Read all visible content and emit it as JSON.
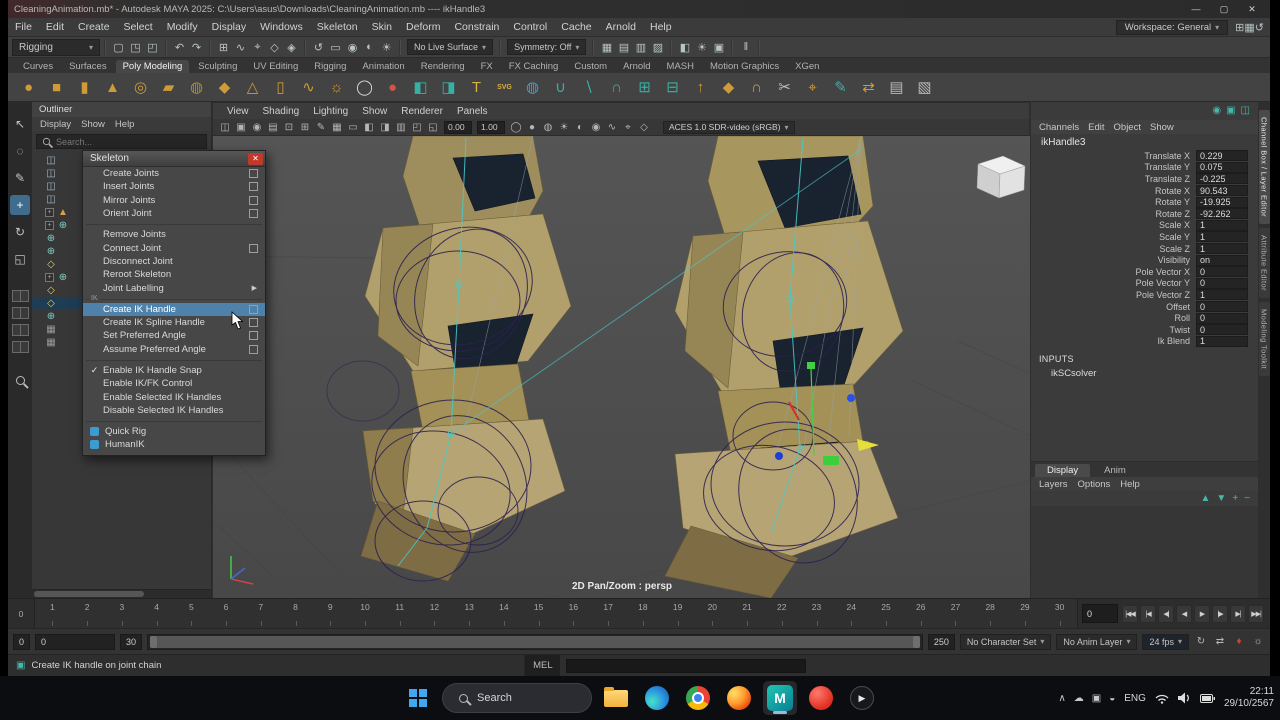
{
  "window": {
    "title": "CleaningAnimation.mb* - Autodesk MAYA 2025: C:\\Users\\asus\\Downloads\\CleaningAnimation.mb  ----  ikHandle3",
    "minimize": "—",
    "maximize": "▢",
    "close": "✕"
  },
  "menubar": {
    "items": [
      "File",
      "Edit",
      "Create",
      "Select",
      "Modify",
      "Display",
      "Windows",
      "Skeleton",
      "Skin",
      "Deform",
      "Constrain",
      "Control",
      "Cache",
      "Arnold",
      "Help"
    ],
    "workspace": "Workspace: General",
    "right_icons": [
      {
        "name": "workspace-layout-icon",
        "glyph": "⊞"
      },
      {
        "name": "panel-grid-icon",
        "glyph": "▦"
      },
      {
        "name": "reset-workspace-icon",
        "glyph": "↺"
      }
    ]
  },
  "statusline": {
    "mode": "Rigging",
    "no_live_surface": "No Live Surface",
    "symmetry": "Symmetry: Off",
    "groups_left": [
      [
        {
          "name": "new-scene-icon",
          "glyph": "▢"
        },
        {
          "name": "open-scene-icon",
          "glyph": "◳"
        },
        {
          "name": "save-scene-icon",
          "glyph": "◰"
        }
      ],
      [
        {
          "name": "undo-icon",
          "glyph": "↶"
        },
        {
          "name": "redo-icon",
          "glyph": "↷"
        }
      ],
      [
        {
          "name": "snap-grid-icon",
          "glyph": "⊞"
        },
        {
          "name": "snap-curve-icon",
          "glyph": "∿"
        },
        {
          "name": "snap-point-icon",
          "glyph": "⌖"
        },
        {
          "name": "snap-plane-icon",
          "glyph": "◇"
        },
        {
          "name": "make-live-icon",
          "glyph": "◈"
        }
      ],
      [
        {
          "name": "construction-history-icon",
          "glyph": "↺"
        },
        {
          "name": "open-render-view-icon",
          "glyph": "▭"
        },
        {
          "name": "render-frame-icon",
          "glyph": "◉"
        },
        {
          "name": "ipr-render-icon",
          "glyph": "◐"
        },
        {
          "name": "render-settings-icon",
          "glyph": "☀"
        }
      ]
    ],
    "groups_right": [
      [
        {
          "name": "grid-display-icon",
          "glyph": "▦"
        },
        {
          "name": "isolate-select-icon",
          "glyph": "▤"
        },
        {
          "name": "wireframe-icon",
          "glyph": "▥"
        },
        {
          "name": "shaded-display-icon",
          "glyph": "▨"
        }
      ],
      [
        {
          "name": "xray-icon",
          "glyph": "◧"
        },
        {
          "name": "lighting-icon",
          "glyph": "☀"
        },
        {
          "name": "textured-icon",
          "glyph": "▣"
        }
      ],
      [
        {
          "name": "pause-viewport-icon",
          "glyph": "‖"
        }
      ]
    ]
  },
  "shelf": {
    "tabs": [
      "Curves",
      "Surfaces",
      "Poly Modeling",
      "Sculpting",
      "UV Editing",
      "Rigging",
      "Animation",
      "Rendering",
      "FX",
      "FX Caching",
      "Custom",
      "Arnold",
      "MASH",
      "Motion Graphics",
      "XGen"
    ],
    "active_tab": "Poly Modeling",
    "icons": [
      {
        "name": "poly-sphere-icon",
        "glyph": "●",
        "color": "#cf9b38"
      },
      {
        "name": "poly-cube-icon",
        "glyph": "■",
        "color": "#cf9b38"
      },
      {
        "name": "poly-cylinder-icon",
        "glyph": "▮",
        "color": "#cf9b38"
      },
      {
        "name": "poly-cone-icon",
        "glyph": "▲",
        "color": "#cf9b38"
      },
      {
        "name": "poly-torus-icon",
        "glyph": "◎",
        "color": "#cf9b38"
      },
      {
        "name": "poly-plane-icon",
        "glyph": "▰",
        "color": "#cf9b38"
      },
      {
        "name": "poly-disc-icon",
        "glyph": "◍",
        "color": "#b98a2e"
      },
      {
        "name": "platonic-solid-icon",
        "glyph": "◆",
        "color": "#cf9b38"
      },
      {
        "name": "poly-pyramid-icon",
        "glyph": "△",
        "color": "#cf9b38"
      },
      {
        "name": "poly-pipe-icon",
        "glyph": "▯",
        "color": "#cf9b38"
      },
      {
        "name": "poly-helix-icon",
        "glyph": "∿",
        "color": "#cf9b38"
      },
      {
        "name": "poly-gear-icon",
        "glyph": "☼",
        "color": "#cf9b38"
      },
      {
        "name": "poly-soccerball-icon",
        "glyph": "◯",
        "color": "#d8d8d8"
      },
      {
        "name": "red-sphere-icon",
        "glyph": "●",
        "color": "#cc5544"
      },
      {
        "name": "sculpt-a-icon",
        "glyph": "◧",
        "color": "#37b0a5"
      },
      {
        "name": "sculpt-b-icon",
        "glyph": "◨",
        "color": "#37b0a5"
      },
      {
        "name": "poly-type-icon",
        "glyph": "T",
        "color": "#d8b145"
      },
      {
        "name": "svg-tool-icon",
        "glyph": "SVG",
        "color": "#d8b145",
        "small": true
      },
      {
        "name": "uv-sphere-icon",
        "glyph": "◍",
        "color": "#4a9bd0"
      },
      {
        "name": "boolean-union-icon",
        "glyph": "∪",
        "color": "#37b0a5"
      },
      {
        "name": "boolean-difference-icon",
        "glyph": "∖",
        "color": "#37b0a5"
      },
      {
        "name": "boolean-intersect-icon",
        "glyph": "∩",
        "color": "#37b0a5"
      },
      {
        "name": "combine-icon",
        "glyph": "⊞",
        "color": "#37b0a5"
      },
      {
        "name": "separate-icon",
        "glyph": "⊟",
        "color": "#37b0a5"
      },
      {
        "name": "extrude-icon",
        "glyph": "↑",
        "color": "#cf9b38"
      },
      {
        "name": "bevel-icon",
        "glyph": "◆",
        "color": "#cf9b38"
      },
      {
        "name": "bridge-icon",
        "glyph": "∩",
        "color": "#cf9b38"
      },
      {
        "name": "multicut-icon",
        "glyph": "✂",
        "color": "#c0c0c0"
      },
      {
        "name": "target-weld-icon",
        "glyph": "⌖",
        "color": "#cf9b38"
      },
      {
        "name": "quad-draw-icon",
        "glyph": "✎",
        "color": "#37b0a5"
      },
      {
        "name": "mirror-icon",
        "glyph": "⇄",
        "color": "#cf9b38"
      },
      {
        "name": "crease-set-icon",
        "glyph": "▤",
        "color": "#b9b9b9"
      },
      {
        "name": "tutorials-icon",
        "glyph": "▧",
        "color": "#b9b9b9"
      }
    ]
  },
  "toolbox": {
    "tools": [
      {
        "name": "select-tool-icon",
        "glyph": "↖"
      },
      {
        "name": "lasso-tool-icon",
        "glyph": "◌"
      },
      {
        "name": "paint-select-tool-icon",
        "glyph": "✎"
      },
      {
        "name": "move-tool-icon",
        "glyph": "+",
        "active": true
      },
      {
        "name": "rotate-tool-icon",
        "glyph": "↻"
      },
      {
        "name": "scale-tool-icon",
        "glyph": "◱"
      }
    ],
    "layouts": [
      "layout-single-pane-button",
      "layout-four-pane-button",
      "layout-split-pane-button",
      "layout-outliner-persp-button"
    ]
  },
  "outliner": {
    "title": "Outliner",
    "menus": [
      "Display",
      "Show",
      "Help"
    ],
    "search_placeholder": "Search...",
    "rows": [
      {
        "glyph": "◫",
        "color": "#9fb6c9"
      },
      {
        "glyph": "◫",
        "color": "#9fb6c9"
      },
      {
        "glyph": "◫",
        "color": "#9fb6c9"
      },
      {
        "glyph": "◫",
        "color": "#9fb6c9"
      },
      {
        "glyph": "▲",
        "color": "#d99f4c",
        "expander": true
      },
      {
        "glyph": "⊕",
        "color": "#7fd0c8",
        "expander": true
      },
      {
        "glyph": "⊕",
        "color": "#7fd0c8"
      },
      {
        "glyph": "⊕",
        "color": "#7fd0c8"
      },
      {
        "glyph": "◇",
        "color": "#d9d06a"
      },
      {
        "glyph": "⊕",
        "color": "#7fd0c8",
        "expander": true
      },
      {
        "glyph": "◇",
        "color": "#d9d06a"
      },
      {
        "glyph": "◇",
        "color": "#d9d06a",
        "selected": true
      },
      {
        "glyph": "⊕",
        "color": "#7fd0c8"
      },
      {
        "glyph": "▦",
        "color": "#9a9a9a"
      },
      {
        "glyph": "▦",
        "color": "#9a9a9a"
      }
    ]
  },
  "skeleton_menu": {
    "title": "Skeleton",
    "close": "✕",
    "check_glyph": "✓",
    "submenu_glyph": "▶",
    "items": [
      {
        "label": "Create Joints",
        "option": true
      },
      {
        "label": "Insert Joints",
        "option": true
      },
      {
        "label": "Mirror Joints",
        "option": true
      },
      {
        "label": "Orient Joint",
        "option": true
      },
      {
        "sep": true
      },
      {
        "label": "Remove Joints"
      },
      {
        "label": "Connect Joint",
        "option": true
      },
      {
        "label": "Disconnect Joint"
      },
      {
        "label": "Reroot Skeleton"
      },
      {
        "label": "Joint Labelling",
        "submenu": true
      },
      {
        "sep": true,
        "label": "IK"
      },
      {
        "label": "Create IK Handle",
        "option": true,
        "highlight": true
      },
      {
        "label": "Create IK Spline Handle",
        "option": true
      },
      {
        "label": "Set Preferred Angle",
        "option": true
      },
      {
        "label": "Assume Preferred Angle",
        "option": true
      },
      {
        "sep": true
      },
      {
        "label": "Enable IK Handle Snap",
        "checked": true
      },
      {
        "label": "Enable IK/FK Control"
      },
      {
        "label": "Enable Selected IK Handles"
      },
      {
        "label": "Disable Selected IK Handles"
      },
      {
        "sep": true
      },
      {
        "label": "Quick Rig",
        "icon": true
      },
      {
        "label": "HumanIK",
        "icon": true
      }
    ]
  },
  "viewport": {
    "menus": [
      "View",
      "Shading",
      "Lighting",
      "Show",
      "Renderer",
      "Panels"
    ],
    "toolbar_icons_a": [
      {
        "name": "select-camera-icon",
        "glyph": "◫"
      },
      {
        "name": "lock-camera-icon",
        "glyph": "▣"
      },
      {
        "name": "camera-attributes-icon",
        "glyph": "◉"
      },
      {
        "name": "bookmark-icon",
        "glyph": "▤"
      },
      {
        "name": "image-plane-icon",
        "glyph": "⊡"
      },
      {
        "name": "2d-pan-zoom-icon",
        "glyph": "⊞"
      },
      {
        "name": "grease-pencil-icon",
        "glyph": "✎"
      },
      {
        "name": "grid-icon",
        "glyph": "▦"
      },
      {
        "name": "film-gate-icon",
        "glyph": "▭"
      },
      {
        "name": "resolution-gate-icon",
        "glyph": "◧"
      },
      {
        "name": "gate-mask-icon",
        "glyph": "◨"
      },
      {
        "name": "field-chart-icon",
        "glyph": "▥"
      },
      {
        "name": "safe-action-icon",
        "glyph": "◰"
      },
      {
        "name": "safe-title-icon",
        "glyph": "◱"
      }
    ],
    "exposure": "0.00",
    "gamma": "1.00",
    "toolbar_icons_b": [
      {
        "name": "wireframe-shading-icon",
        "glyph": "◯"
      },
      {
        "name": "shaded-icon",
        "glyph": "●"
      },
      {
        "name": "textured-shading-icon",
        "glyph": "◍"
      },
      {
        "name": "use-all-lights-icon",
        "glyph": "☀"
      },
      {
        "name": "shadows-icon",
        "glyph": "◐"
      },
      {
        "name": "ao-icon",
        "glyph": "◉"
      },
      {
        "name": "motion-blur-icon",
        "glyph": "∿"
      },
      {
        "name": "isolate-select-icon",
        "glyph": "⌖"
      },
      {
        "name": "xray-display-icon",
        "glyph": "◇"
      }
    ],
    "colorspace": "ACES 1.0 SDR-video (sRGB)",
    "overlay_label": "2D Pan/Zoom : persp"
  },
  "channel_box": {
    "top_icons": [
      {
        "name": "pin-channelbox-icon",
        "glyph": "◉"
      },
      {
        "name": "channel-display-icon",
        "glyph": "▣"
      },
      {
        "name": "channel-settings-icon",
        "glyph": "◫"
      }
    ],
    "menus": [
      "Channels",
      "Edit",
      "Object",
      "Show"
    ],
    "node": "ikHandle3",
    "attributes": [
      {
        "name": "Translate X",
        "value": "0.229"
      },
      {
        "name": "Translate Y",
        "value": "0.075"
      },
      {
        "name": "Translate Z",
        "value": "-0.225"
      },
      {
        "name": "Rotate X",
        "value": "90.543"
      },
      {
        "name": "Rotate Y",
        "value": "-19.925"
      },
      {
        "name": "Rotate Z",
        "value": "-92.262"
      },
      {
        "name": "Scale X",
        "value": "1"
      },
      {
        "name": "Scale Y",
        "value": "1"
      },
      {
        "name": "Scale Z",
        "value": "1"
      },
      {
        "name": "Visibility",
        "value": "on"
      },
      {
        "name": "Pole Vector X",
        "value": "0"
      },
      {
        "name": "Pole Vector Y",
        "value": "0"
      },
      {
        "name": "Pole Vector Z",
        "value": "1"
      },
      {
        "name": "Offset",
        "value": "0"
      },
      {
        "name": "Roll",
        "value": "0"
      },
      {
        "name": "Twist",
        "value": "0"
      },
      {
        "name": "Ik Blend",
        "value": "1"
      }
    ],
    "inputs_label": "INPUTS",
    "inputs": [
      "ikSCsolver"
    ]
  },
  "layer_editor": {
    "tabs": [
      "Display",
      "Anim"
    ],
    "active_tab": "Display",
    "menus": [
      "Layers",
      "Options",
      "Help"
    ],
    "icons": [
      {
        "name": "move-layer-up-icon",
        "glyph": "▲"
      },
      {
        "name": "move-layer-down-icon",
        "glyph": "▼"
      },
      {
        "name": "add-layer-icon",
        "glyph": "+"
      },
      {
        "name": "add-selected-layer-icon",
        "glyph": "−"
      }
    ]
  },
  "side_tabs": [
    "Channel Box / Layer Editor",
    "Attribute Editor",
    "Modeling Toolkit"
  ],
  "timeline": {
    "left_value": "0",
    "frames": [
      "1",
      "2",
      "3",
      "4",
      "5",
      "6",
      "7",
      "8",
      "9",
      "10",
      "11",
      "12",
      "13",
      "14",
      "15",
      "16",
      "17",
      "18",
      "19",
      "20",
      "21",
      "22",
      "23",
      "24",
      "25",
      "26",
      "27",
      "28",
      "29",
      "30"
    ],
    "current_frame": "0",
    "playback": [
      {
        "name": "go-to-start-button",
        "glyph": "|◀◀"
      },
      {
        "name": "step-back-frame-button",
        "glyph": "|◀"
      },
      {
        "name": "step-back-key-button",
        "glyph": "◀|"
      },
      {
        "name": "play-backwards-button",
        "glyph": "◀"
      },
      {
        "name": "play-forwards-button",
        "glyph": "▶"
      },
      {
        "name": "step-forward-key-button",
        "glyph": "|▶"
      },
      {
        "name": "step-forward-frame-button",
        "glyph": "▶|"
      },
      {
        "name": "go-to-end-button",
        "glyph": "▶▶|"
      }
    ]
  },
  "range_slider": {
    "anim_start": "0",
    "playback_start": "0",
    "playback_end": "30",
    "anim_end": "250",
    "character_set": "No Character Set",
    "anim_layer": "No Anim Layer",
    "fps": "24 fps",
    "icons_right": [
      {
        "name": "playback-loop-icon",
        "glyph": "↻"
      },
      {
        "name": "playback-speed-icon",
        "glyph": "⇄"
      },
      {
        "name": "auto-keyframe-icon",
        "glyph": "♦",
        "color": "#cc4433"
      },
      {
        "name": "animation-preferences-icon",
        "glyph": "☼"
      }
    ]
  },
  "command_line": {
    "help_icon": "▣",
    "help_text": "Create IK handle on joint chain",
    "mel_label": "MEL"
  },
  "taskbar": {
    "search_label": "Search",
    "apps": [
      {
        "name": "start-button"
      },
      {
        "name": "search-box"
      },
      {
        "name": "file-explorer-icon"
      },
      {
        "name": "edge-icon"
      },
      {
        "name": "chrome-icon"
      },
      {
        "name": "firefox-icon"
      },
      {
        "name": "maya-icon",
        "active": true,
        "letter": "M"
      },
      {
        "name": "red-app-icon"
      },
      {
        "name": "media-player-icon",
        "glyph": "▶"
      }
    ],
    "tray": {
      "icons": [
        {
          "name": "hidden-icons-caret",
          "glyph": "∧"
        },
        {
          "name": "onedrive-icon",
          "glyph": "☁"
        },
        {
          "name": "security-icon",
          "glyph": "▣"
        },
        {
          "name": "update-icon",
          "glyph": "◒"
        }
      ],
      "language": "ENG",
      "time": "22:11",
      "date": "29/10/2567"
    }
  }
}
